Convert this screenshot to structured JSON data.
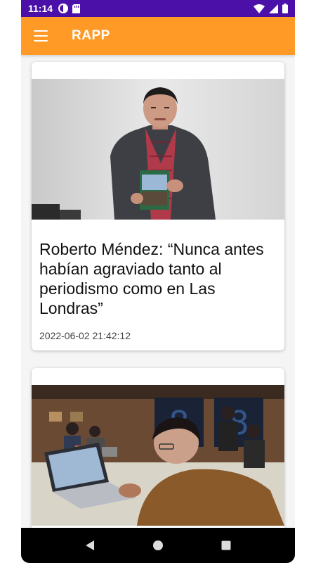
{
  "status_bar": {
    "time": "11:14",
    "left_icons": [
      "data-saver-icon",
      "sd-card-icon"
    ],
    "right_icons": [
      "wifi-icon",
      "signal-icon",
      "battery-icon"
    ]
  },
  "app_bar": {
    "title": "RAPP",
    "menu_icon": "hamburger-menu-icon",
    "background": "#ff9a26"
  },
  "articles": [
    {
      "title": "Roberto Méndez: “Nunca antes habían agraviado tanto al periodismo como en Las Londras”",
      "date": "2022-06-02 21:42:12",
      "image": "photo-man-holding-book"
    },
    {
      "title": "",
      "date": "",
      "image": "photo-journalists-with-laptops"
    }
  ],
  "nav_bar": {
    "buttons": [
      "back-icon",
      "home-icon",
      "recents-icon"
    ]
  },
  "colors": {
    "status_bar": "#4a10a8",
    "accent": "#ff9a26"
  }
}
